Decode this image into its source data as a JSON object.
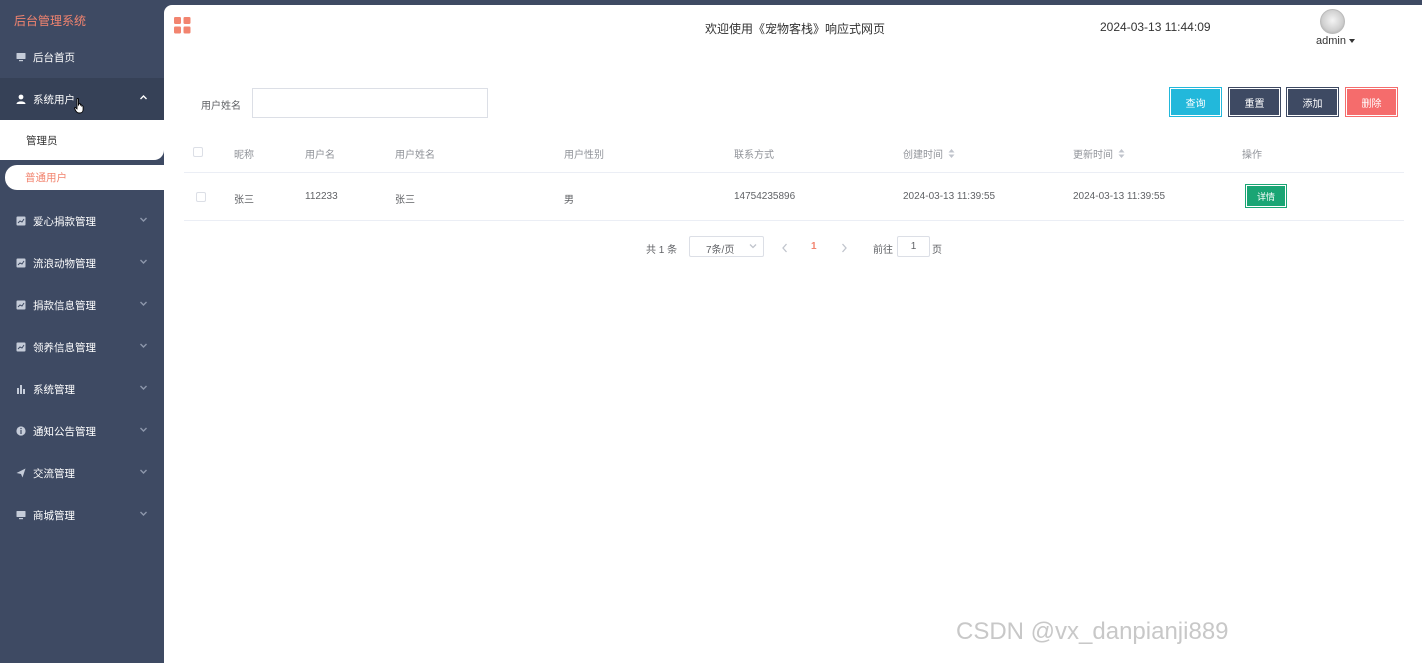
{
  "app": {
    "brand": "后台管理系统"
  },
  "sidebar": {
    "items": [
      {
        "label": "后台首页",
        "icon": "monitor-icon"
      },
      {
        "label": "系统用户",
        "icon": "user-icon",
        "open": true
      },
      {
        "label": "爱心捐款管理",
        "icon": "chart-icon"
      },
      {
        "label": "流浪动物管理",
        "icon": "chart-icon"
      },
      {
        "label": "捐款信息管理",
        "icon": "chart-icon"
      },
      {
        "label": "领养信息管理",
        "icon": "chart-icon"
      },
      {
        "label": "系统管理",
        "icon": "bar-chart-icon"
      },
      {
        "label": "通知公告管理",
        "icon": "info-icon"
      },
      {
        "label": "交流管理",
        "icon": "send-icon"
      },
      {
        "label": "商城管理",
        "icon": "monitor-icon"
      }
    ],
    "submenu": [
      {
        "label": "管理员"
      },
      {
        "label": "普通用户",
        "active": true
      }
    ]
  },
  "header": {
    "welcome": "欢迎使用《宠物客栈》响应式网页",
    "datetime": "2024-03-13 11:44:09",
    "user": "admin"
  },
  "search": {
    "label": "用户姓名",
    "value": "",
    "buttons": {
      "query": "查询",
      "reset": "重置",
      "add": "添加",
      "delete": "删除"
    }
  },
  "table": {
    "columns": [
      "昵称",
      "用户名",
      "用户姓名",
      "用户性别",
      "联系方式",
      "创建时间",
      "更新时间",
      "操作"
    ],
    "rows": [
      {
        "nickname": "张三",
        "username": "112233",
        "name": "张三",
        "gender": "男",
        "phone": "14754235896",
        "created": "2024-03-13 11:39:55",
        "updated": "2024-03-13 11:39:55",
        "action": "详情"
      }
    ]
  },
  "pagination": {
    "total": "共 1 条",
    "page_size": "7条/页",
    "current_page": "1",
    "goto_label": "前往",
    "goto_value": "1",
    "goto_unit": "页"
  },
  "watermark": "CSDN @vx_danpianji889",
  "colors": {
    "sidebar": "#3e4a63",
    "accent": "#f2846f",
    "query": "#22b8db",
    "delete": "#f56c6c",
    "detail": "#1aa574"
  }
}
